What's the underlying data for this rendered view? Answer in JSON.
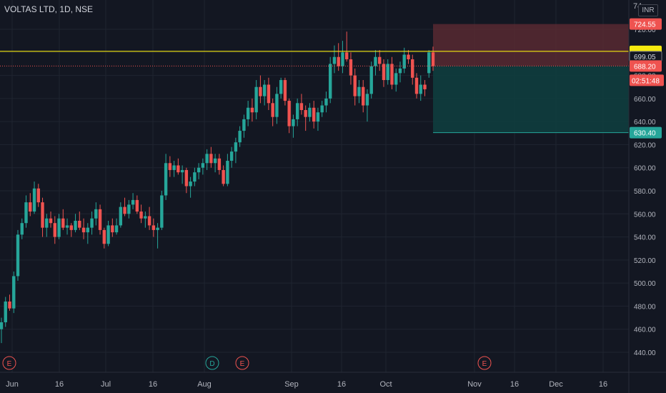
{
  "header": {
    "title": "VOLTAS LTD, 1D, NSE"
  },
  "currency": "INR",
  "top_partial_label": "74",
  "colors": {
    "background": "#131722",
    "grid": "#1f2430",
    "up": "#26a69a",
    "down": "#ef5350",
    "text": "#b2b5be",
    "price_line": "#f5ea0f",
    "stop_zone": "#5c2b33",
    "target_zone": "#0f3d3e"
  },
  "chart_data": {
    "type": "candlestick",
    "y_axis": {
      "min": 430,
      "max": 745,
      "ticks": [
        440,
        460,
        480,
        500,
        520,
        540,
        560,
        580,
        600,
        620,
        640,
        660,
        680,
        700,
        720
      ]
    },
    "x_axis": {
      "labels": [
        "Jun",
        "16",
        "Jul",
        "16",
        "Aug",
        "Sep",
        "16",
        "Oct",
        "Nov",
        "16",
        "Dec",
        "16"
      ]
    },
    "price_labels": {
      "stop": "724.55",
      "current": "699.05",
      "entry": "688.20",
      "countdown": "02:51:48",
      "target": "630.40"
    },
    "events": [
      "E",
      "D",
      "E",
      "E"
    ],
    "ohlc": [
      [
        460,
        470,
        448,
        466
      ],
      [
        466,
        488,
        462,
        484
      ],
      [
        484,
        490,
        476,
        478
      ],
      [
        478,
        510,
        474,
        506
      ],
      [
        506,
        546,
        502,
        542
      ],
      [
        542,
        556,
        538,
        552
      ],
      [
        552,
        576,
        548,
        570
      ],
      [
        570,
        578,
        558,
        562
      ],
      [
        562,
        588,
        560,
        582
      ],
      [
        582,
        586,
        566,
        570
      ],
      [
        570,
        574,
        540,
        548
      ],
      [
        548,
        560,
        540,
        556
      ],
      [
        556,
        562,
        548,
        552
      ],
      [
        552,
        558,
        534,
        540
      ],
      [
        540,
        560,
        538,
        556
      ],
      [
        556,
        564,
        546,
        548
      ],
      [
        548,
        556,
        542,
        550
      ],
      [
        550,
        552,
        540,
        546
      ],
      [
        546,
        560,
        544,
        554
      ],
      [
        554,
        562,
        546,
        548
      ],
      [
        548,
        556,
        538,
        544
      ],
      [
        544,
        552,
        534,
        548
      ],
      [
        548,
        562,
        542,
        556
      ],
      [
        556,
        570,
        550,
        564
      ],
      [
        564,
        568,
        542,
        546
      ],
      [
        546,
        548,
        530,
        534
      ],
      [
        534,
        554,
        532,
        550
      ],
      [
        550,
        556,
        540,
        544
      ],
      [
        544,
        556,
        542,
        550
      ],
      [
        550,
        570,
        548,
        566
      ],
      [
        566,
        574,
        558,
        560
      ],
      [
        560,
        572,
        556,
        568
      ],
      [
        568,
        578,
        564,
        572
      ],
      [
        572,
        576,
        560,
        562
      ],
      [
        562,
        568,
        552,
        556
      ],
      [
        556,
        562,
        548,
        558
      ],
      [
        558,
        566,
        546,
        550
      ],
      [
        550,
        556,
        540,
        546
      ],
      [
        546,
        552,
        530,
        548
      ],
      [
        548,
        580,
        546,
        576
      ],
      [
        576,
        612,
        572,
        604
      ],
      [
        604,
        610,
        592,
        598
      ],
      [
        598,
        606,
        592,
        602
      ],
      [
        602,
        608,
        594,
        596
      ],
      [
        596,
        602,
        586,
        598
      ],
      [
        598,
        600,
        578,
        584
      ],
      [
        584,
        592,
        574,
        588
      ],
      [
        588,
        600,
        584,
        596
      ],
      [
        596,
        604,
        590,
        600
      ],
      [
        600,
        608,
        594,
        604
      ],
      [
        604,
        616,
        598,
        612
      ],
      [
        612,
        618,
        600,
        604
      ],
      [
        604,
        612,
        596,
        608
      ],
      [
        608,
        612,
        594,
        598
      ],
      [
        598,
        602,
        584,
        586
      ],
      [
        586,
        612,
        584,
        606
      ],
      [
        606,
        618,
        600,
        614
      ],
      [
        614,
        626,
        604,
        622
      ],
      [
        622,
        636,
        618,
        632
      ],
      [
        632,
        646,
        626,
        642
      ],
      [
        642,
        658,
        636,
        652
      ],
      [
        652,
        660,
        640,
        648
      ],
      [
        648,
        676,
        642,
        670
      ],
      [
        670,
        680,
        656,
        662
      ],
      [
        662,
        676,
        654,
        672
      ],
      [
        672,
        678,
        650,
        656
      ],
      [
        656,
        660,
        636,
        644
      ],
      [
        644,
        670,
        638,
        664
      ],
      [
        664,
        678,
        660,
        676
      ],
      [
        676,
        678,
        654,
        658
      ],
      [
        658,
        660,
        630,
        636
      ],
      [
        636,
        646,
        626,
        642
      ],
      [
        642,
        660,
        636,
        656
      ],
      [
        656,
        664,
        646,
        650
      ],
      [
        650,
        654,
        632,
        644
      ],
      [
        644,
        656,
        640,
        652
      ],
      [
        652,
        658,
        634,
        640
      ],
      [
        640,
        652,
        632,
        648
      ],
      [
        648,
        658,
        644,
        654
      ],
      [
        654,
        666,
        648,
        660
      ],
      [
        660,
        696,
        656,
        690
      ],
      [
        690,
        706,
        682,
        696
      ],
      [
        696,
        708,
        684,
        688
      ],
      [
        688,
        710,
        682,
        700
      ],
      [
        700,
        718,
        692,
        694
      ],
      [
        694,
        700,
        672,
        680
      ],
      [
        680,
        686,
        654,
        662
      ],
      [
        662,
        676,
        656,
        670
      ],
      [
        670,
        676,
        648,
        654
      ],
      [
        654,
        668,
        640,
        664
      ],
      [
        664,
        692,
        660,
        688
      ],
      [
        688,
        702,
        680,
        696
      ],
      [
        696,
        702,
        684,
        690
      ],
      [
        690,
        694,
        670,
        676
      ],
      [
        676,
        694,
        672,
        690
      ],
      [
        690,
        696,
        668,
        672
      ],
      [
        672,
        686,
        666,
        682
      ],
      [
        682,
        692,
        674,
        686
      ],
      [
        686,
        704,
        682,
        698
      ],
      [
        698,
        702,
        690,
        694
      ],
      [
        694,
        698,
        672,
        678
      ],
      [
        678,
        682,
        660,
        664
      ],
      [
        664,
        680,
        658,
        672
      ],
      [
        672,
        676,
        662,
        668
      ],
      [
        682,
        702,
        678,
        700
      ],
      [
        700,
        705,
        684,
        688
      ]
    ]
  }
}
